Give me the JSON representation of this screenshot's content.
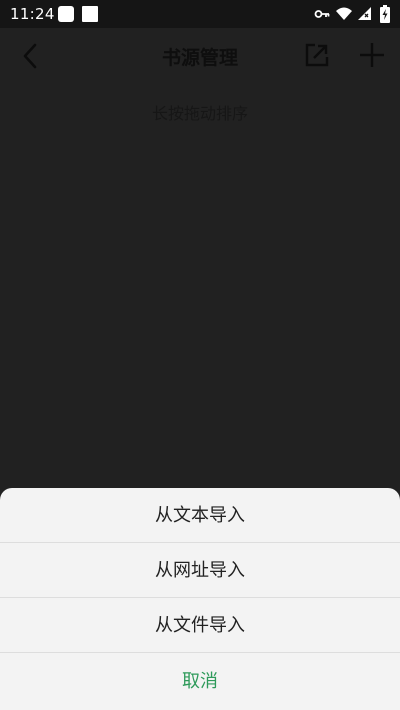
{
  "status_bar": {
    "time": "11:24",
    "icons": [
      "notification-square-icon",
      "notification-square-icon",
      "vpn-key-icon",
      "wifi-icon",
      "signal-icon",
      "battery-charging-icon"
    ]
  },
  "app_bar": {
    "title": "书源管理",
    "back_icon": "chevron-left-icon",
    "export_icon": "export-icon",
    "add_icon": "plus-icon"
  },
  "main": {
    "hint": "长按拖动排序"
  },
  "import_sheet": {
    "items": [
      {
        "label": "从文本导入"
      },
      {
        "label": "从网址导入"
      },
      {
        "label": "从文件导入"
      }
    ],
    "cancel_label": "取消"
  },
  "colors": {
    "background": "#212121",
    "status_bar": "#151515",
    "sheet": "#f3f3f3",
    "cancel_accent": "#2e9a5a"
  }
}
